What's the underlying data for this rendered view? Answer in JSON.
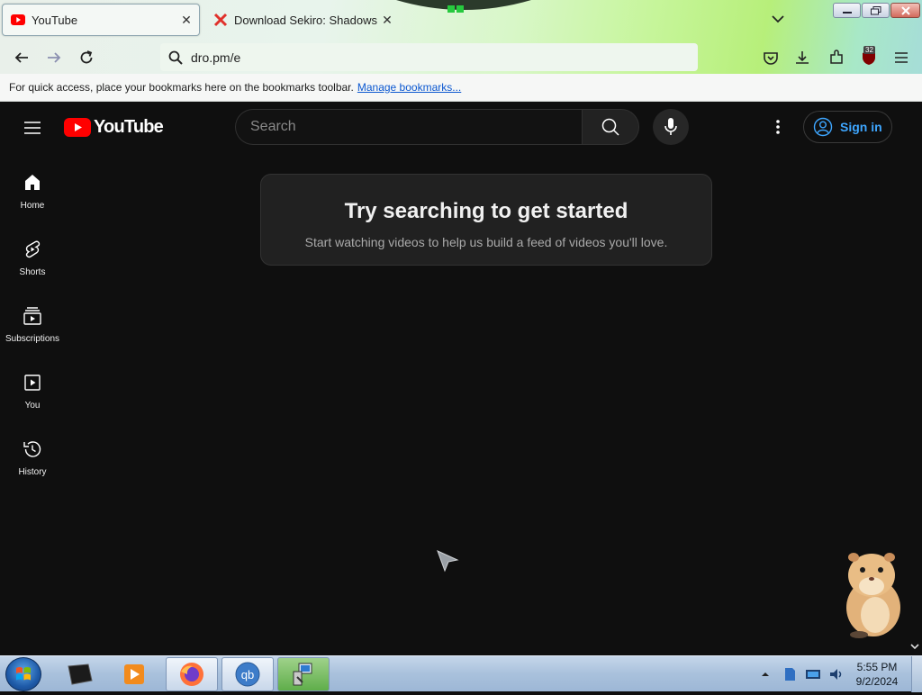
{
  "browser": {
    "tabs": [
      {
        "title": "YouTube",
        "icon": "youtube-favicon",
        "active": true
      },
      {
        "title": "Download Sekiro: Shadows Die",
        "icon": "x-favicon",
        "active": false
      }
    ],
    "url": "dro.pm/e",
    "extension_badge": "32",
    "bookmarks_bar": {
      "message": "For quick access, place your bookmarks here on the bookmarks toolbar.",
      "link": "Manage bookmarks..."
    }
  },
  "youtube": {
    "logo_text": "YouTube",
    "search_placeholder": "Search",
    "sign_in": "Sign in",
    "guide": [
      {
        "label": "Home",
        "icon": "home-icon"
      },
      {
        "label": "Shorts",
        "icon": "shorts-icon"
      },
      {
        "label": "Subscriptions",
        "icon": "subscriptions-icon"
      },
      {
        "label": "You",
        "icon": "you-icon"
      },
      {
        "label": "History",
        "icon": "history-icon"
      }
    ],
    "empty_state": {
      "title": "Try searching to get started",
      "subtitle": "Start watching videos to help us build a feed of videos you'll love."
    }
  },
  "taskbar": {
    "time": "5:55 PM",
    "date": "9/2/2024"
  },
  "colors": {
    "yt_red": "#ff0000",
    "signin_blue": "#3ea6ff",
    "page_bg": "#0f0f0f"
  }
}
